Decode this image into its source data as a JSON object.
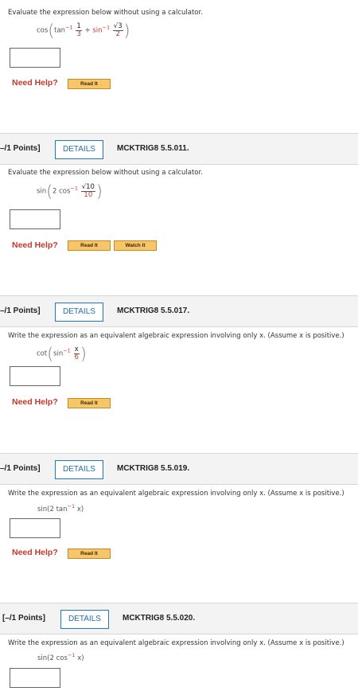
{
  "questions": [
    {
      "prompt": "Evaluate the expression below without using a calculator.",
      "expr": {
        "fn": "cos",
        "inner1": "tan",
        "sup": "−1",
        "frac1_num": "1",
        "frac1_den": "3",
        "plus": "+",
        "inner2": "sin",
        "frac2_num": "√3",
        "frac2_den": "2"
      },
      "help_label": "Need Help?",
      "read_label": "Read It"
    },
    {
      "points": "–/1 Points]",
      "details_label": "DETAILS",
      "code": "MCKTRIG8 5.5.011.",
      "prompt": "Evaluate the expression below without using a calculator.",
      "expr": {
        "fn": "sin",
        "lead": "2 cos",
        "sup": "−1",
        "frac_num": "√10",
        "frac_den": "10"
      },
      "help_label": "Need Help?",
      "read_label": "Read It",
      "watch_label": "Watch It"
    },
    {
      "points": "–/1 Points]",
      "details_label": "DETAILS",
      "code": "MCKTRIG8 5.5.017.",
      "prompt": "Write the expression as an equivalent algebraic expression involving only x. (Assume x is positive.)",
      "expr": {
        "fn": "cot",
        "inner": "sin",
        "sup": "−1",
        "frac_num": "x",
        "frac_den": "6"
      },
      "help_label": "Need Help?",
      "read_label": "Read It"
    },
    {
      "points": "–/1 Points]",
      "details_label": "DETAILS",
      "code": "MCKTRIG8 5.5.019.",
      "prompt": "Write the expression as an equivalent algebraic expression involving only x. (Assume x is positive.)",
      "expr": {
        "pre": "sin(2 tan",
        "sup": "−1",
        "post": " x)"
      },
      "help_label": "Need Help?",
      "read_label": "Read It"
    },
    {
      "points": "[–/1 Points]",
      "details_label": "DETAILS",
      "code": "MCKTRIG8 5.5.020.",
      "prompt": "Write the expression as an equivalent algebraic expression involving only x. (Assume x is positive.)",
      "expr": {
        "pre": "sin(2 cos",
        "sup": "−1",
        "post": " x)"
      }
    }
  ]
}
